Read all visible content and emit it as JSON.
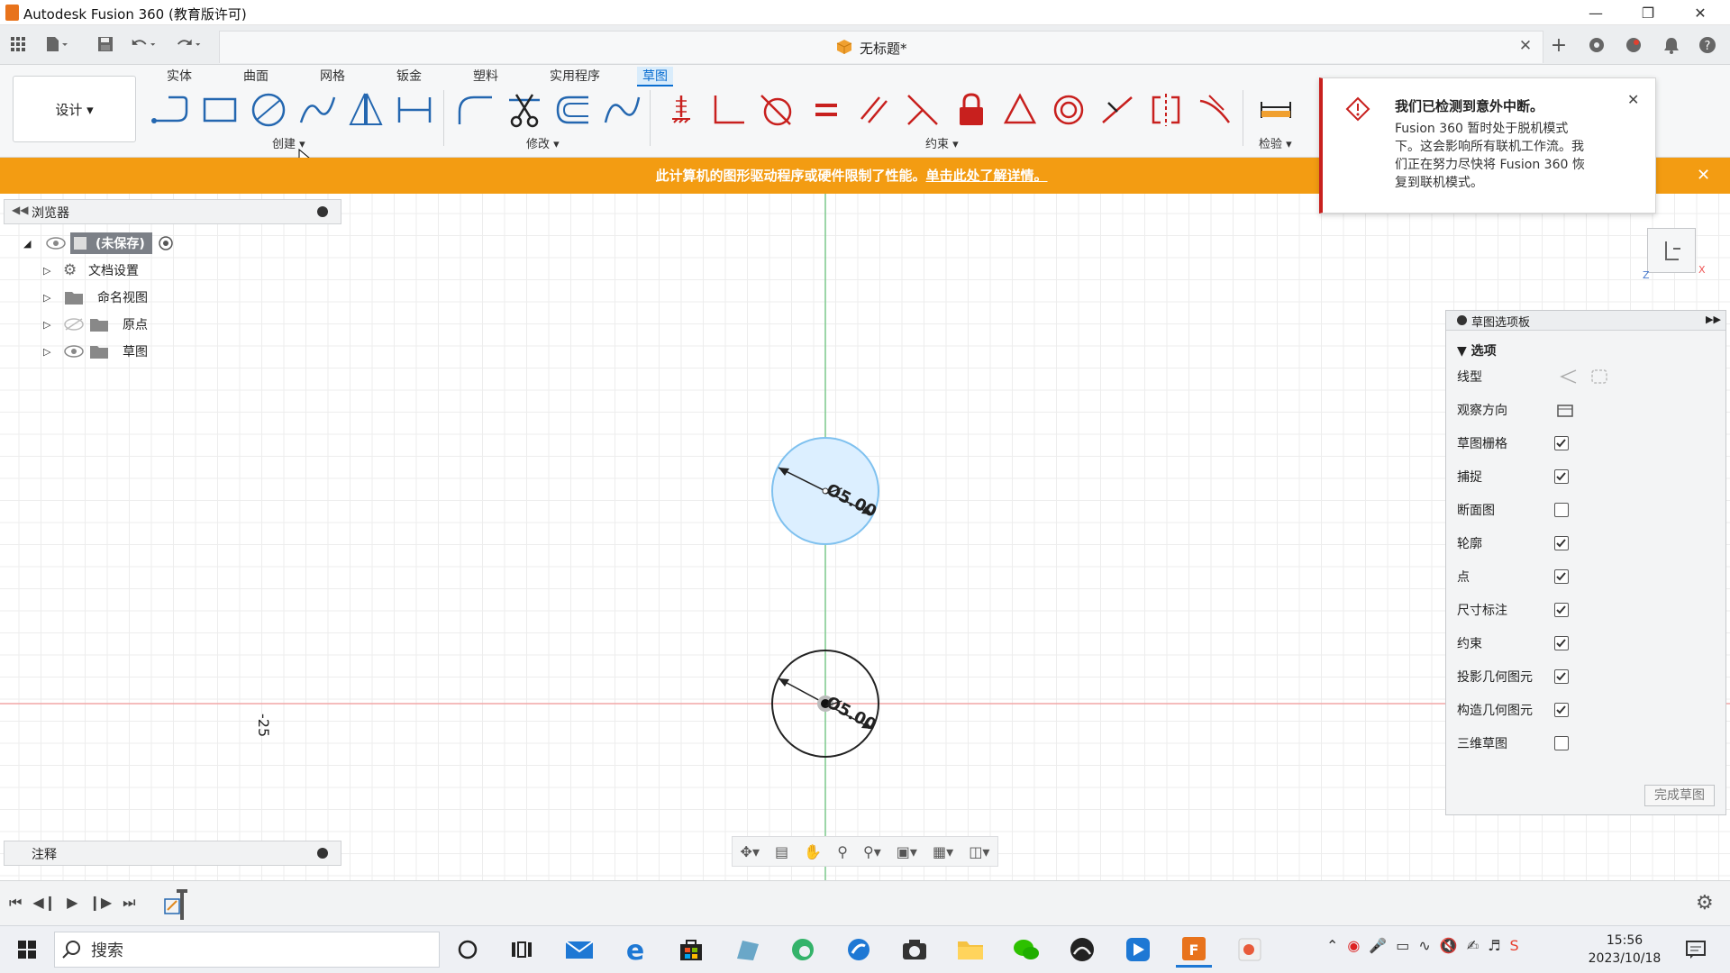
{
  "window": {
    "title": "Autodesk Fusion 360 (教育版许可)",
    "app_icon_color": "#e8731c"
  },
  "tabbar": {
    "document_title": "无标题*"
  },
  "ribbon": {
    "workspace": "设计 ▾",
    "tabs": [
      "实体",
      "曲面",
      "网格",
      "钣金",
      "塑料",
      "实用程序",
      "草图"
    ],
    "active_tab": "草图",
    "groups": {
      "create": "创建 ▾",
      "modify": "修改 ▾",
      "constraints": "约束 ▾",
      "inspect": "检验 ▾"
    }
  },
  "warning": {
    "text": "此计算机的图形驱动程序或硬件限制了性能。",
    "link": "单击此处了解详情。",
    "color": "#f39c12"
  },
  "browser": {
    "title": "浏览器",
    "root": "(未保存)",
    "items": [
      "文档设置",
      "命名视图",
      "原点",
      "草图"
    ]
  },
  "notes": {
    "title": "注释"
  },
  "canvas": {
    "dim_upper": "Ø5.00",
    "dim_lower": "Ø5.00",
    "axis_label": "-25"
  },
  "notification": {
    "title": "我们已检测到意外中断。",
    "body_lines": [
      "Fusion 360 暂时处于脱机模式",
      "下。这会影响所有联机工作流。我",
      "们正在努力尽快将 Fusion 360 恢",
      "复到联机模式。"
    ]
  },
  "palette": {
    "title": "草图选项板",
    "section": "选项",
    "rows": [
      {
        "label": "线型",
        "type": "icons"
      },
      {
        "label": "观察方向",
        "type": "icon"
      },
      {
        "label": "草图栅格",
        "checked": true
      },
      {
        "label": "捕捉",
        "checked": true
      },
      {
        "label": "断面图",
        "checked": false
      },
      {
        "label": "轮廓",
        "checked": true
      },
      {
        "label": "点",
        "checked": true
      },
      {
        "label": "尺寸标注",
        "checked": true
      },
      {
        "label": "约束",
        "checked": true
      },
      {
        "label": "投影几何图元",
        "checked": true
      },
      {
        "label": "构造几何图元",
        "checked": true
      },
      {
        "label": "三维草图",
        "checked": false
      }
    ],
    "finish_button": "完成草图"
  },
  "taskbar": {
    "search_placeholder": "搜索",
    "time": "15:56",
    "date": "2023/10/18"
  }
}
